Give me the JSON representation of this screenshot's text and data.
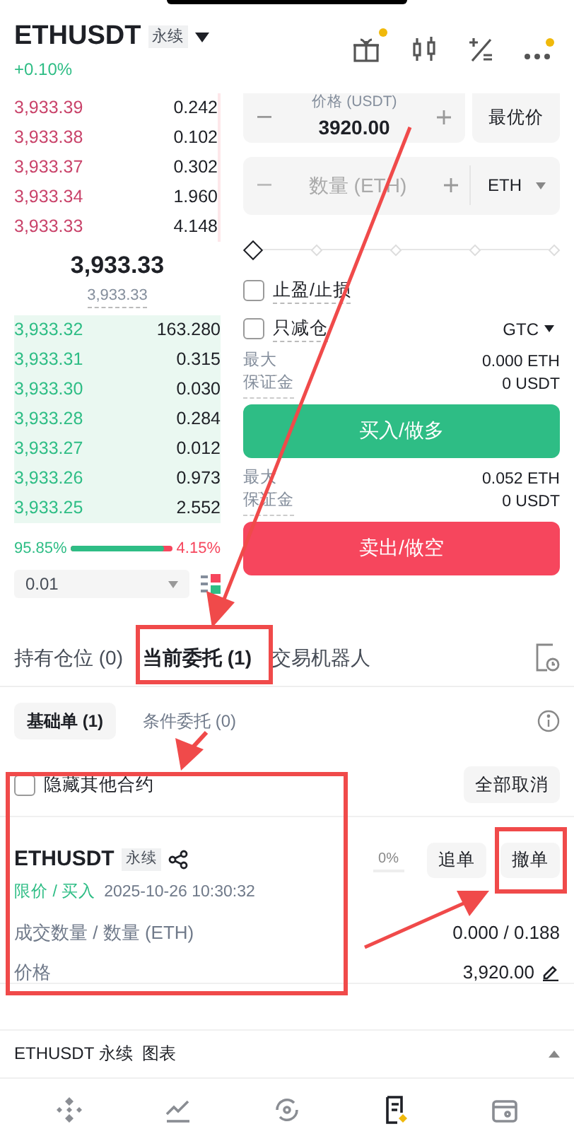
{
  "header": {
    "symbol": "ETHUSDT",
    "type_badge": "永续",
    "change": "+0.10%"
  },
  "order_book": {
    "asks": [
      {
        "price": "3,933.39",
        "amount": "0.242"
      },
      {
        "price": "3,933.38",
        "amount": "0.102"
      },
      {
        "price": "3,933.37",
        "amount": "0.302"
      },
      {
        "price": "3,933.34",
        "amount": "1.960"
      },
      {
        "price": "3,933.33",
        "amount": "4.148"
      }
    ],
    "last_price": "3,933.33",
    "mark_price": "3,933.33",
    "bids": [
      {
        "price": "3,933.32",
        "amount": "163.280"
      },
      {
        "price": "3,933.31",
        "amount": "0.315"
      },
      {
        "price": "3,933.30",
        "amount": "0.030"
      },
      {
        "price": "3,933.28",
        "amount": "0.284"
      },
      {
        "price": "3,933.27",
        "amount": "0.012"
      },
      {
        "price": "3,933.26",
        "amount": "0.973"
      },
      {
        "price": "3,933.25",
        "amount": "2.552"
      }
    ],
    "buy_ratio": "95.85%",
    "sell_ratio": "4.15%",
    "level": 0.9585,
    "precision": "0.01"
  },
  "order_form": {
    "price_label": "价格 (USDT)",
    "price_value": "3920.00",
    "best_price_button": "最优价",
    "quantity_placeholder": "数量 (ETH)",
    "unit": "ETH",
    "slider": {
      "level": 0
    },
    "options": [
      {
        "label": "止盈/止损",
        "checked": false
      },
      {
        "label": "只减仓",
        "checked": false
      }
    ],
    "time_in_force": "GTC",
    "buy_info": [
      {
        "label": "最大",
        "value": "0.000 ETH"
      },
      {
        "label": "保证金",
        "value": "0 USDT"
      }
    ],
    "buy_button": "买入/做多",
    "sell_info": [
      {
        "label": "最大",
        "value": "0.052 ETH"
      },
      {
        "label": "保证金",
        "value": "0 USDT"
      }
    ],
    "sell_button": "卖出/做空"
  },
  "tabs": [
    {
      "label": "持有仓位 (0)",
      "selected": false
    },
    {
      "label": "当前委托 (1)",
      "selected": true
    },
    {
      "label": "交易机器人",
      "selected": false
    }
  ],
  "subtabs": [
    {
      "label": "基础单 (1)",
      "selected": true
    },
    {
      "label": "条件委托 (0)",
      "selected": false
    }
  ],
  "hide_other": {
    "label": "隐藏其他合约",
    "checked": false
  },
  "cancel_all_button": "全部取消",
  "order": {
    "symbol": "ETHUSDT",
    "type_badge": "永续",
    "fill_percent": "0%",
    "chase_button": "追单",
    "cancel_button": "撤单",
    "side": "限价 / 买入",
    "time": "2025-10-26 10:30:32",
    "rows": [
      {
        "label": "成交数量 / 数量 (ETH)",
        "value": "0.000 / 0.188"
      },
      {
        "label": "价格",
        "value": "3,920.00"
      }
    ]
  },
  "chart_bar": {
    "label": "ETHUSDT 永续  图表"
  },
  "bottom_nav": [
    {
      "selected": false
    },
    {
      "selected": false
    },
    {
      "selected": false
    },
    {
      "selected": true
    },
    {
      "selected": false
    }
  ]
}
